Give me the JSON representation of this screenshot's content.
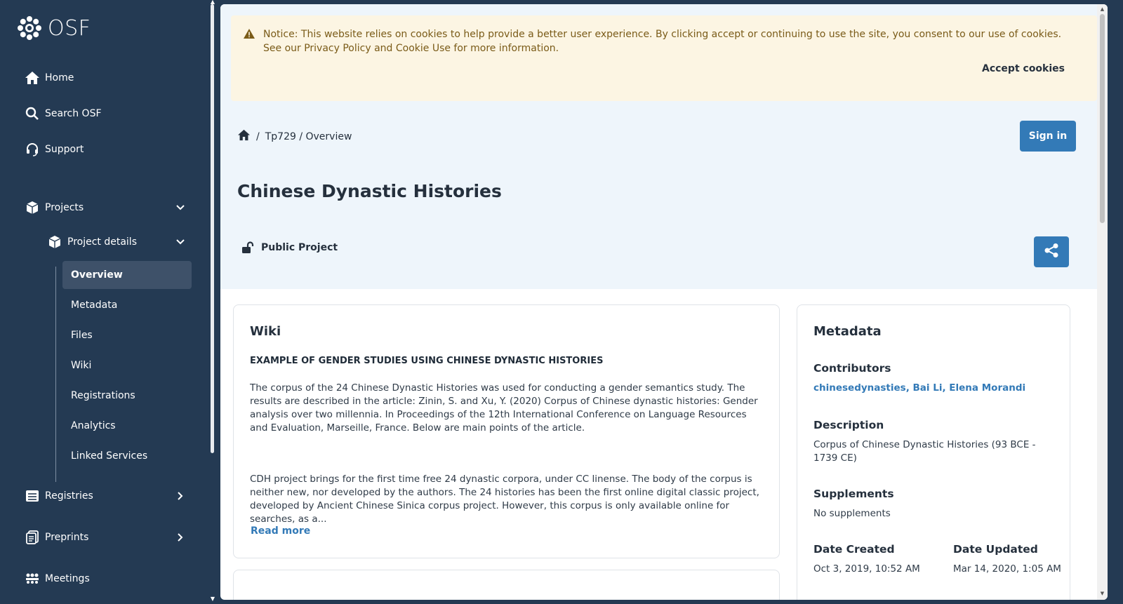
{
  "sidebar": {
    "logo_text": "OSF",
    "nav": {
      "home": "Home",
      "search": "Search OSF",
      "support": "Support",
      "projects": "Projects",
      "project_details": "Project details",
      "registries": "Registries",
      "preprints": "Preprints",
      "meetings": "Meetings"
    },
    "sub_items": [
      "Overview",
      "Metadata",
      "Files",
      "Wiki",
      "Registrations",
      "Analytics",
      "Linked Services"
    ],
    "active_sub_item": "Overview"
  },
  "cookie_notice": {
    "text": "Notice: This website relies on cookies to help provide a better user experience. By clicking accept or continuing to use the site, you consent to our use of cookies. See our Privacy Policy and Cookie Use for more information.",
    "accept_label": "Accept cookies"
  },
  "breadcrumb": {
    "separator": "/",
    "path": "Tp729 / Overview"
  },
  "header": {
    "sign_in_label": "Sign in",
    "title": "Chinese Dynastic Histories",
    "visibility": "Public Project"
  },
  "wiki": {
    "title": "Wiki",
    "heading": "EXAMPLE OF GENDER STUDIES USING CHINESE DYNASTIC HISTORIES",
    "paragraph1": "The corpus of the 24 Chinese Dynastic Histories was used for conducting a gender semantics study. The results are described in the article: Zinin, S. and Xu, Y. (2020) Corpus of Chinese dynastic histories: Gender analysis over two millennia. In Proceedings of the 12th International Conference on Language Resources and Evaluation, Marseille, France. Below are main points of the article.",
    "paragraph2": "CDH project brings for the first time free 24 dynastic corpora, under CC linense. The body of the corpus is neither new, nor developed by the authors. The 24 histories has been the first online digital classic project, developed by Ancient Chinese Sinica corpus project. However, this corpus is only available online for searches, as a...",
    "read_more_label": "Read more"
  },
  "metadata": {
    "title": "Metadata",
    "contributors_label": "Contributors",
    "contributors": "chinesedynasties, Bai Li, Elena Morandi",
    "description_label": "Description",
    "description": "Corpus of Chinese Dynastic Histories (93 BCE - 1739 CE)",
    "supplements_label": "Supplements",
    "supplements": "No supplements",
    "date_created_label": "Date Created",
    "date_created": "Oct 3, 2019, 10:52 AM",
    "date_updated_label": "Date Updated",
    "date_updated": "Mar 14, 2020, 1:05 AM"
  },
  "colors": {
    "sidebar_bg": "#243a53",
    "primary": "#337ab7",
    "hero_bg": "#eef5fb",
    "notice_bg": "#fcf5e3"
  }
}
